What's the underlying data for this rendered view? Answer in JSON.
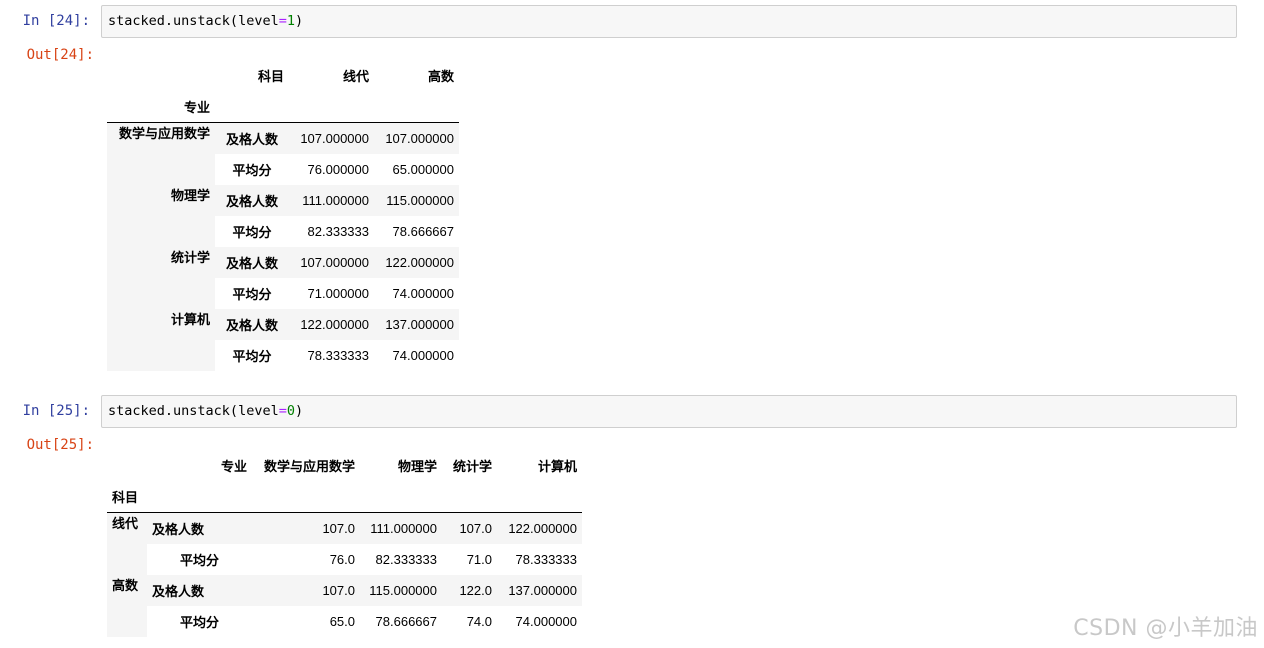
{
  "cells": [
    {
      "in_prompt": "In  [24]:",
      "code": {
        "obj": "stacked.unstack",
        "open": "(",
        "kw": "level",
        "eq": "=",
        "num": "1",
        "close": ")"
      },
      "out_prompt": "Out[24]:",
      "table": {
        "col_index_name": "科目",
        "columns": [
          "线代",
          "高数"
        ],
        "row_index_name": "专业",
        "groups": [
          {
            "label": "数学与应用数学",
            "rows": [
              {
                "sub": "及格人数",
                "values": [
                  "107.000000",
                  "107.000000"
                ]
              },
              {
                "sub": "平均分",
                "values": [
                  "76.000000",
                  "65.000000"
                ]
              }
            ]
          },
          {
            "label": "物理学",
            "rows": [
              {
                "sub": "及格人数",
                "values": [
                  "111.000000",
                  "115.000000"
                ]
              },
              {
                "sub": "平均分",
                "values": [
                  "82.333333",
                  "78.666667"
                ]
              }
            ]
          },
          {
            "label": "统计学",
            "rows": [
              {
                "sub": "及格人数",
                "values": [
                  "107.000000",
                  "122.000000"
                ]
              },
              {
                "sub": "平均分",
                "values": [
                  "71.000000",
                  "74.000000"
                ]
              }
            ]
          },
          {
            "label": "计算机",
            "rows": [
              {
                "sub": "及格人数",
                "values": [
                  "122.000000",
                  "137.000000"
                ]
              },
              {
                "sub": "平均分",
                "values": [
                  "78.333333",
                  "74.000000"
                ]
              }
            ]
          }
        ]
      }
    },
    {
      "in_prompt": "In  [25]:",
      "code": {
        "obj": "stacked.unstack",
        "open": "(",
        "kw": "level",
        "eq": "=",
        "num": "0",
        "close": ")"
      },
      "out_prompt": "Out[25]:",
      "table": {
        "col_index_name": "专业",
        "columns": [
          "数学与应用数学",
          "物理学",
          "统计学",
          "计算机"
        ],
        "row_index_name": "科目",
        "groups": [
          {
            "label": "线代",
            "rows": [
              {
                "sub": "及格人数",
                "values": [
                  "107.0",
                  "111.000000",
                  "107.0",
                  "122.000000"
                ]
              },
              {
                "sub": "平均分",
                "values": [
                  "76.0",
                  "82.333333",
                  "71.0",
                  "78.333333"
                ]
              }
            ]
          },
          {
            "label": "高数",
            "rows": [
              {
                "sub": "及格人数",
                "values": [
                  "107.0",
                  "115.000000",
                  "122.0",
                  "137.000000"
                ]
              },
              {
                "sub": "平均分",
                "values": [
                  "65.0",
                  "78.666667",
                  "74.0",
                  "74.000000"
                ]
              }
            ]
          }
        ]
      }
    }
  ],
  "watermark": "CSDN @小羊加油"
}
